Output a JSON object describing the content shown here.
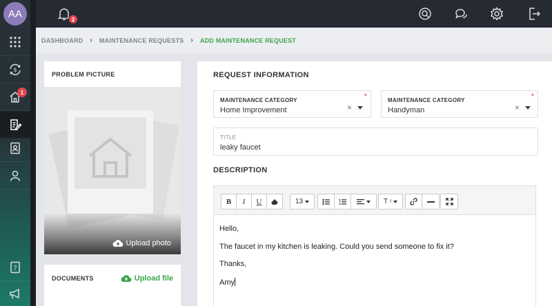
{
  "user": {
    "initials": "AA"
  },
  "topbar": {
    "notification_count": "2"
  },
  "sidebar": {
    "home_badge": "1"
  },
  "breadcrumb": {
    "items": [
      "DASHBOARD",
      "MAINTENANCE REQUESTS"
    ],
    "current": "ADD MAINTENANCE REQUEST"
  },
  "problem_picture": {
    "title": "PROBLEM PICTURE",
    "upload_label": "Upload photo"
  },
  "documents": {
    "title": "DOCUMENTS",
    "upload_label": "Upload file"
  },
  "form": {
    "section_title": "REQUEST INFORMATION",
    "category1": {
      "label": "MAINTENANCE CATEGORY",
      "value": "Home Improvement",
      "required_mark": "*"
    },
    "category2": {
      "label": "MAINTENANCE CATEGORY",
      "value": "Handyman",
      "required_mark": "*"
    },
    "title_field": {
      "label": "TITLE",
      "value": "leaky faucet"
    },
    "description_title": "DESCRIPTION",
    "toolbar": {
      "bold": "B",
      "italic": "I",
      "underline": "U",
      "font_size": "13",
      "text_format": "T"
    },
    "description_lines": [
      "Hello,",
      "The faucet in my kitchen is leaking. Could you send someone to fix it?",
      "Thanks,",
      "Amy"
    ]
  },
  "colors": {
    "accent": "#3ba54b",
    "badge": "#e0454f",
    "topbar": "#262a32"
  }
}
